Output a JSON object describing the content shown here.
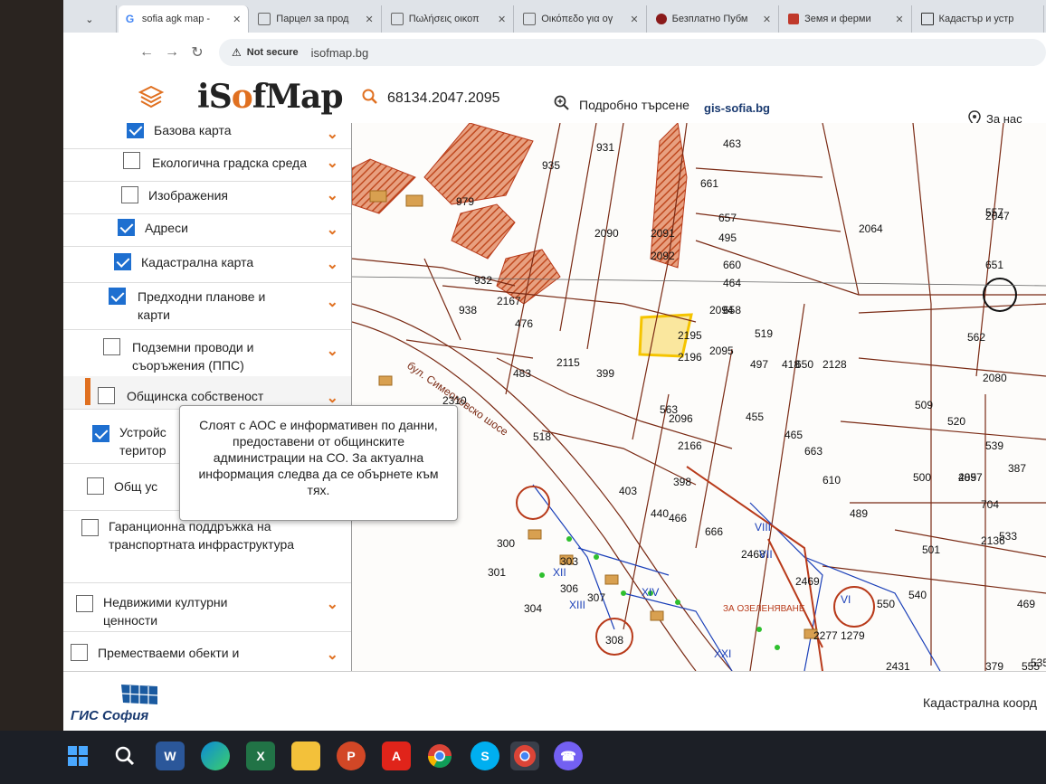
{
  "browser": {
    "tabs": [
      {
        "label": "sofia agk map - ",
        "icon": "google-icon",
        "active": true
      },
      {
        "label": "Парцел за прод",
        "icon": "site-icon"
      },
      {
        "label": "Πωλήσεις οικοπ",
        "icon": "site-icon"
      },
      {
        "label": "Οικόπεδο για ογ",
        "icon": "site-icon"
      },
      {
        "label": "Безплатно Пубм",
        "icon": "site-icon"
      },
      {
        "label": "Земя и ферми",
        "icon": "site-icon"
      },
      {
        "label": "Кадастър и устр",
        "icon": "site-icon"
      }
    ],
    "not_secure": "Not secure",
    "url": "isofmap.bg"
  },
  "header": {
    "logo_i": "i",
    "logo_s": "S",
    "logo_o": "o",
    "logo_rest": "fMap",
    "search_value": "68134.2047.2095",
    "advanced_search": "Подробно търсене",
    "gis_link": "gis-sofia.bg",
    "contact": "За нас"
  },
  "sidebar": {
    "layers": [
      {
        "label": "Базова карта",
        "checked": true
      },
      {
        "label": "Екологична градска среда",
        "checked": false
      },
      {
        "label": "Изображения",
        "checked": false
      },
      {
        "label": "Адреси",
        "checked": true
      },
      {
        "label": "Кадастрална карта",
        "checked": true
      },
      {
        "label": "Предходни планове и карти",
        "checked": true
      },
      {
        "label": "Подземни проводи и съоръжения (ППС)",
        "checked": false
      },
      {
        "label": "Общинска собственост",
        "checked": false
      },
      {
        "label": "Устройс територ",
        "checked": true
      },
      {
        "label": "Общ ус",
        "checked": false
      },
      {
        "label": "Гаранционна поддръжка на транспортната инфраструктура",
        "checked": false
      },
      {
        "label": "Недвижими културни ценности",
        "checked": false
      },
      {
        "label": "Преместваеми обекти и",
        "checked": false
      }
    ]
  },
  "tooltip": {
    "text": "Слоят с АОС е информативен по данни, предоставени от общинските администрации на СО. За актуална информация следва да се обърнете към тях."
  },
  "map": {
    "parcel_numbers": [
      "931",
      "935",
      "463",
      "661",
      "657",
      "495",
      "660",
      "464",
      "658",
      "497",
      "519",
      "418",
      "2128",
      "650",
      "2064",
      "557",
      "2047",
      "651",
      "562",
      "387",
      "2080",
      "509",
      "520",
      "539",
      "2097",
      "485",
      "704",
      "533",
      "2136",
      "469",
      "500",
      "501",
      "540",
      "550",
      "2431",
      "379",
      "555",
      "535",
      "2094",
      "2095",
      "2195",
      "2196",
      "2090",
      "2091",
      "2092",
      "2115",
      "399",
      "563",
      "455",
      "465",
      "663",
      "610",
      "489",
      "2096",
      "2166",
      "398",
      "403",
      "440",
      "466",
      "666",
      "2468",
      "2469",
      "979",
      "932",
      "938",
      "2167",
      "476",
      "483",
      "2310",
      "518",
      "300",
      "301",
      "304",
      "303",
      "306",
      "307",
      "308",
      "2277",
      "1279"
    ],
    "roman_labels": [
      "VIII",
      "VII",
      "XII",
      "XIII",
      "XIV",
      "XXI",
      "VI"
    ],
    "street_label": "бул. Симеоновско шосе",
    "green_zone_label": "ЗА ОЗЕЛЕНЯВАНЕ"
  },
  "footer": {
    "gis_logo": "ГИС София",
    "coords_label": "Кадастрална коорд"
  },
  "taskbar": {
    "apps": [
      "windows-start-icon",
      "search-icon",
      "word-icon",
      "edge-icon",
      "excel-icon",
      "file-explorer-icon",
      "powerpoint-icon",
      "acrobat-icon",
      "chrome-icon",
      "skype-icon",
      "chrome-profile-icon",
      "viber-icon"
    ]
  },
  "colors": {
    "accent_orange": "#e07020",
    "checkbox_blue": "#1e6fd0",
    "parcel_line": "#7a2a14",
    "highlight_parcel": "#f5c400"
  }
}
